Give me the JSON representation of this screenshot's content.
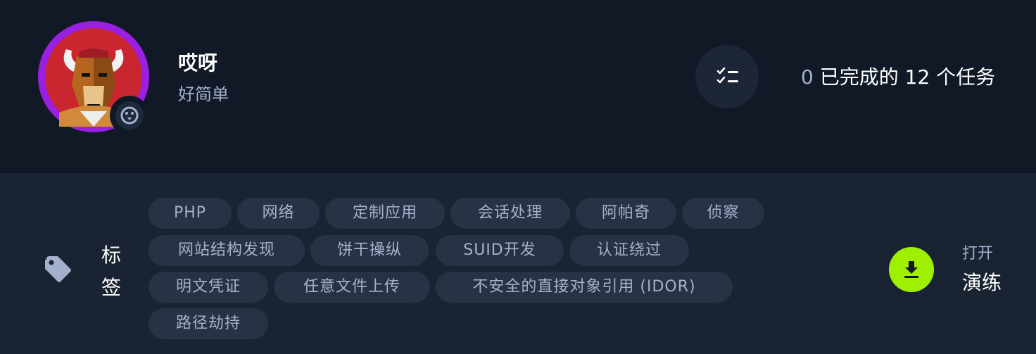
{
  "machine": {
    "name": "哎呀",
    "difficulty": "好简单"
  },
  "tasks": {
    "completed": "0",
    "label": "已完成的 12 个任务"
  },
  "tags": {
    "label_line1": "标",
    "label_line2": "签",
    "items": [
      "PHP",
      "网络",
      "定制应用",
      "会话处理",
      "阿帕奇",
      "侦察",
      "网站结构发现",
      "饼干操纵",
      "SUID开发",
      "认证绕过",
      "明文凭证",
      "任意文件上传",
      "不安全的直接对象引用 (IDOR)",
      "路径劫持"
    ]
  },
  "action": {
    "line1": "打开",
    "line2": "演练"
  },
  "colors": {
    "accent_green": "#9fef00",
    "avatar_ring": "#9b1fe0",
    "background": "#111927"
  }
}
